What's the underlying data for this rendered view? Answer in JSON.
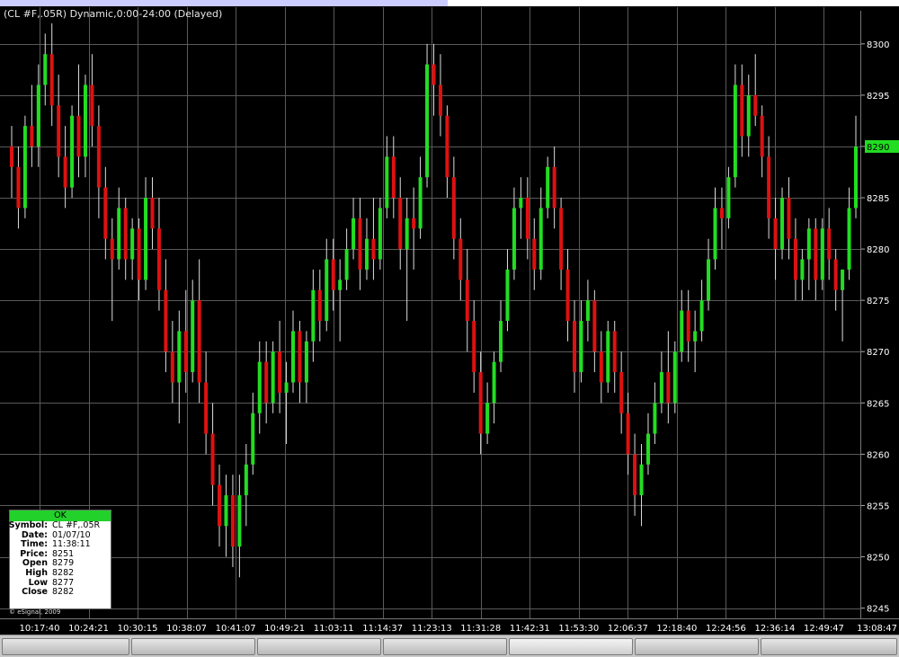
{
  "chart_title": "(CL #F,.05R) Dynamic,0:00-24:00 (Delayed)",
  "copyright": "© eSignal, 2009",
  "colors": {
    "background": "#000000",
    "grid": "#5a5a5a",
    "up_bar": "#22dd22",
    "down_bar": "#dd1111",
    "wick": "#dddddd",
    "axis_text": "#ffffff",
    "current_price_marker": "#22dd22"
  },
  "info_box": {
    "status": "OK",
    "rows": [
      {
        "label": "Symbol:",
        "value": "CL #F,.05R"
      },
      {
        "label": "Date:",
        "value": "01/07/10"
      },
      {
        "label": "Time:",
        "value": "11:38:11"
      },
      {
        "label": "Price:",
        "value": "8251"
      },
      {
        "label": "Open",
        "value": "8279"
      },
      {
        "label": "High",
        "value": "8282"
      },
      {
        "label": "Low",
        "value": "8277"
      },
      {
        "label": "Close",
        "value": "8282"
      }
    ]
  },
  "chart_data": {
    "type": "candlestick",
    "title": "(CL #F,.05R) Dynamic,0:00-24:00 (Delayed)",
    "y_ticks": [
      "8245",
      "8250",
      "8255",
      "8260",
      "8265",
      "8270",
      "8275",
      "8280",
      "8285",
      "8290",
      "8295",
      "8300"
    ],
    "ylim": [
      8244,
      8302
    ],
    "x_ticks": [
      "10:17:40",
      "10:24:21",
      "10:30:15",
      "10:38:07",
      "10:41:07",
      "10:49:21",
      "11:03:11",
      "11:14:37",
      "11:23:13",
      "11:31:28",
      "11:42:31",
      "11:53:30",
      "12:06:37",
      "12:18:40",
      "12:24:56",
      "12:36:14",
      "12:49:47",
      "13:08:47"
    ],
    "last_price": "8290",
    "grid": true,
    "bars": [
      [
        8290,
        8292,
        8285,
        8288
      ],
      [
        8288,
        8290,
        8282,
        8284
      ],
      [
        8284,
        8293,
        8283,
        8292
      ],
      [
        8292,
        8296,
        8288,
        8290
      ],
      [
        8290,
        8298,
        8288,
        8296
      ],
      [
        8296,
        8301,
        8294,
        8299
      ],
      [
        8299,
        8302,
        8292,
        8294
      ],
      [
        8294,
        8297,
        8287,
        8289
      ],
      [
        8289,
        8292,
        8284,
        8286
      ],
      [
        8286,
        8294,
        8285,
        8293
      ],
      [
        8293,
        8298,
        8287,
        8289
      ],
      [
        8289,
        8297,
        8287,
        8296
      ],
      [
        8296,
        8299,
        8290,
        8292
      ],
      [
        8292,
        8294,
        8283,
        8286
      ],
      [
        8286,
        8288,
        8279,
        8281
      ],
      [
        8281,
        8283,
        8273,
        8279
      ],
      [
        8279,
        8286,
        8278,
        8284
      ],
      [
        8284,
        8285,
        8277,
        8279
      ],
      [
        8279,
        8283,
        8277,
        8282
      ],
      [
        8282,
        8283,
        8275,
        8277
      ],
      [
        8277,
        8287,
        8276,
        8285
      ],
      [
        8285,
        8287,
        8280,
        8282
      ],
      [
        8282,
        8285,
        8274,
        8276
      ],
      [
        8276,
        8279,
        8268,
        8270
      ],
      [
        8270,
        8273,
        8265,
        8267
      ],
      [
        8267,
        8274,
        8263,
        8272
      ],
      [
        8272,
        8276,
        8266,
        8268
      ],
      [
        8268,
        8277,
        8267,
        8275
      ],
      [
        8275,
        8279,
        8265,
        8267
      ],
      [
        8267,
        8270,
        8260,
        8262
      ],
      [
        8262,
        8265,
        8255,
        8257
      ],
      [
        8257,
        8259,
        8251,
        8253
      ],
      [
        8253,
        8258,
        8250,
        8256
      ],
      [
        8256,
        8258,
        8249,
        8251
      ],
      [
        8251,
        8258,
        8248,
        8256
      ],
      [
        8256,
        8261,
        8253,
        8259
      ],
      [
        8259,
        8266,
        8258,
        8264
      ],
      [
        8264,
        8271,
        8262,
        8269
      ],
      [
        8269,
        8271,
        8263,
        8265
      ],
      [
        8265,
        8271,
        8264,
        8270
      ],
      [
        8270,
        8273,
        8264,
        8266
      ],
      [
        8266,
        8269,
        8261,
        8267
      ],
      [
        8267,
        8274,
        8266,
        8272
      ],
      [
        8272,
        8273,
        8265,
        8267
      ],
      [
        8267,
        8272,
        8265,
        8271
      ],
      [
        8271,
        8278,
        8269,
        8276
      ],
      [
        8276,
        8278,
        8271,
        8273
      ],
      [
        8273,
        8281,
        8272,
        8279
      ],
      [
        8279,
        8281,
        8274,
        8276
      ],
      [
        8276,
        8279,
        8271,
        8277
      ],
      [
        8277,
        8282,
        8276,
        8280
      ],
      [
        8280,
        8285,
        8279,
        8283
      ],
      [
        8283,
        8285,
        8276,
        8278
      ],
      [
        8278,
        8283,
        8277,
        8281
      ],
      [
        8281,
        8285,
        8277,
        8279
      ],
      [
        8279,
        8285,
        8278,
        8284
      ],
      [
        8284,
        8291,
        8283,
        8289
      ],
      [
        8289,
        8291,
        8283,
        8285
      ],
      [
        8285,
        8287,
        8278,
        8280
      ],
      [
        8280,
        8285,
        8273,
        8283
      ],
      [
        8283,
        8286,
        8278,
        8282
      ],
      [
        8282,
        8289,
        8281,
        8287
      ],
      [
        8287,
        8300,
        8286,
        8298
      ],
      [
        8298,
        8300,
        8293,
        8296
      ],
      [
        8296,
        8299,
        8291,
        8293
      ],
      [
        8293,
        8294,
        8285,
        8287
      ],
      [
        8287,
        8289,
        8279,
        8281
      ],
      [
        8281,
        8283,
        8275,
        8277
      ],
      [
        8277,
        8280,
        8270,
        8273
      ],
      [
        8273,
        8275,
        8266,
        8268
      ],
      [
        8268,
        8270,
        8260,
        8262
      ],
      [
        8262,
        8267,
        8261,
        8265
      ],
      [
        8265,
        8270,
        8263,
        8269
      ],
      [
        8269,
        8275,
        8268,
        8273
      ],
      [
        8273,
        8280,
        8272,
        8278
      ],
      [
        8278,
        8286,
        8277,
        8284
      ],
      [
        8284,
        8287,
        8281,
        8285
      ],
      [
        8285,
        8287,
        8279,
        8281
      ],
      [
        8281,
        8283,
        8276,
        8278
      ],
      [
        8278,
        8286,
        8277,
        8284
      ],
      [
        8284,
        8289,
        8283,
        8288
      ],
      [
        8288,
        8290,
        8282,
        8284
      ],
      [
        8284,
        8285,
        8276,
        8278
      ],
      [
        8278,
        8280,
        8271,
        8273
      ],
      [
        8273,
        8275,
        8266,
        8268
      ],
      [
        8268,
        8275,
        8267,
        8273
      ],
      [
        8273,
        8277,
        8271,
        8275
      ],
      [
        8275,
        8276,
        8268,
        8270
      ],
      [
        8270,
        8272,
        8265,
        8267
      ],
      [
        8267,
        8273,
        8266,
        8272
      ],
      [
        8272,
        8273,
        8266,
        8268
      ],
      [
        8268,
        8270,
        8262,
        8264
      ],
      [
        8264,
        8266,
        8258,
        8260
      ],
      [
        8260,
        8262,
        8254,
        8256
      ],
      [
        8256,
        8261,
        8253,
        8259
      ],
      [
        8259,
        8264,
        8258,
        8262
      ],
      [
        8262,
        8267,
        8261,
        8265
      ],
      [
        8265,
        8270,
        8264,
        8268
      ],
      [
        8268,
        8272,
        8263,
        8265
      ],
      [
        8265,
        8271,
        8264,
        8270
      ],
      [
        8270,
        8276,
        8269,
        8274
      ],
      [
        8274,
        8276,
        8269,
        8271
      ],
      [
        8271,
        8274,
        8268,
        8272
      ],
      [
        8272,
        8277,
        8271,
        8275
      ],
      [
        8275,
        8281,
        8274,
        8279
      ],
      [
        8279,
        8286,
        8278,
        8284
      ],
      [
        8284,
        8286,
        8280,
        8283
      ],
      [
        8283,
        8288,
        8282,
        8287
      ],
      [
        8287,
        8298,
        8286,
        8296
      ],
      [
        8296,
        8298,
        8289,
        8291
      ],
      [
        8291,
        8297,
        8289,
        8295
      ],
      [
        8295,
        8299,
        8292,
        8293
      ],
      [
        8293,
        8294,
        8287,
        8289
      ],
      [
        8289,
        8291,
        8281,
        8283
      ],
      [
        8283,
        8285,
        8277,
        8280
      ],
      [
        8280,
        8286,
        8279,
        8285
      ],
      [
        8285,
        8287,
        8279,
        8281
      ],
      [
        8281,
        8283,
        8275,
        8277
      ],
      [
        8277,
        8280,
        8275,
        8279
      ],
      [
        8279,
        8283,
        8276,
        8282
      ],
      [
        8282,
        8283,
        8275,
        8277
      ],
      [
        8277,
        8283,
        8276,
        8282
      ],
      [
        8282,
        8284,
        8277,
        8279
      ],
      [
        8279,
        8280,
        8274,
        8276
      ],
      [
        8276,
        8278,
        8271,
        8278
      ],
      [
        8278,
        8286,
        8277,
        8284
      ],
      [
        8284,
        8293,
        8283,
        8290
      ]
    ]
  }
}
